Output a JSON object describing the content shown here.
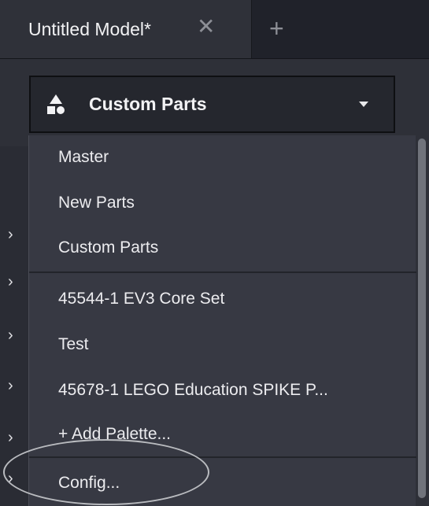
{
  "tabs": [
    {
      "label": "Untitled Model*",
      "active": true
    }
  ],
  "tab_close_glyph": "✕",
  "tab_add_glyph": "+",
  "palette_dropdown": {
    "selected": "Custom Parts",
    "icon": "shapes-icon"
  },
  "menu": {
    "group1": [
      "Master",
      "New Parts",
      "Custom Parts"
    ],
    "group2": [
      "45544-1 EV3 Core Set",
      "Test",
      "45678-1 LEGO Education SPIKE P...",
      "+ Add Palette..."
    ],
    "group3": [
      "Config..."
    ]
  },
  "colors": {
    "background": "#2e3038",
    "menu_bg": "#373943",
    "annotation": "#b9bbbf"
  }
}
